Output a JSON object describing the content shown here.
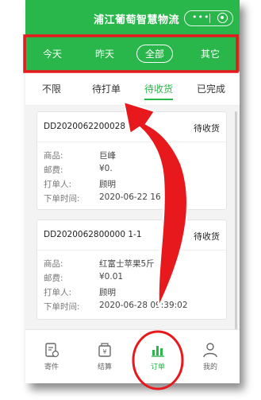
{
  "app": {
    "title": "浦江葡萄智慧物流"
  },
  "date_tabs": [
    {
      "label": "今天"
    },
    {
      "label": "昨天"
    },
    {
      "label": "全部"
    },
    {
      "label": "其它"
    }
  ],
  "status_tabs": [
    {
      "label": "不限"
    },
    {
      "label": "待打单"
    },
    {
      "label": "待收货"
    },
    {
      "label": "已完成"
    }
  ],
  "orders": [
    {
      "order_no": "DD2020062200028",
      "status": "待收货",
      "goods_label": "商品:",
      "goods_value": "巨峰",
      "fee_label": "邮费:",
      "fee_value": "¥0.",
      "printer_label": "打单人:",
      "printer_value": "顾明",
      "time_label": "下单时间:",
      "time_value": "2020-06-22 16"
    },
    {
      "order_no": "DD2020062800000 1-1",
      "status": "待收货",
      "goods_label": "商品:",
      "goods_value": "红富士苹果5斤",
      "fee_label": "邮费:",
      "fee_value": "¥0.01",
      "printer_label": "打单人:",
      "printer_value": "顾明",
      "time_label": "下单时间:",
      "time_value": "2020-06-28 09:39:02"
    }
  ],
  "bottom_nav": [
    {
      "label": "寄件",
      "icon": "send-package-icon"
    },
    {
      "label": "结算",
      "icon": "settlement-icon"
    },
    {
      "label": "订单",
      "icon": "orders-chart-icon"
    },
    {
      "label": "我的",
      "icon": "profile-icon"
    }
  ],
  "colors": {
    "brand": "#29b64a",
    "annotation": "#e8191c"
  }
}
